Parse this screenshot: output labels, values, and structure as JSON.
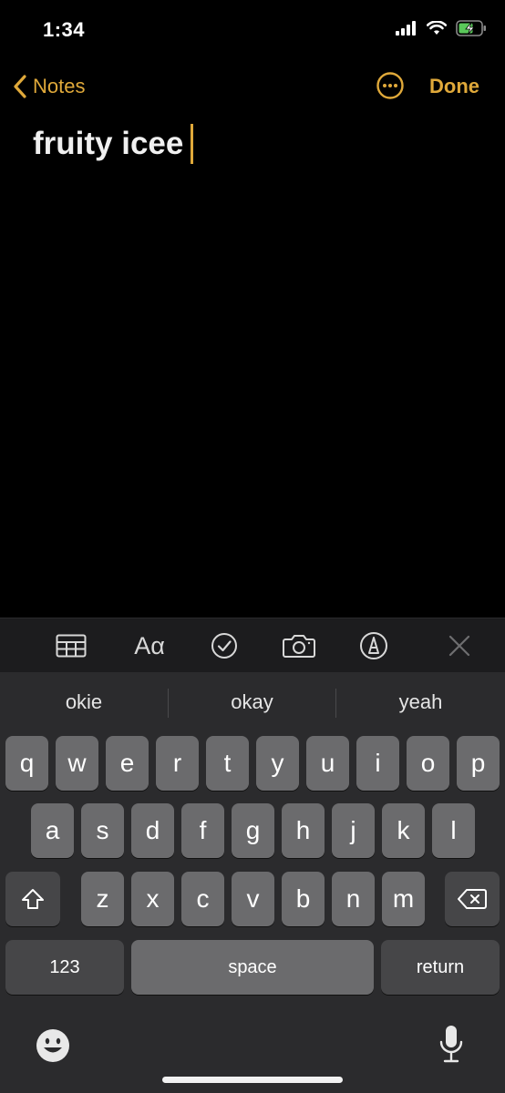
{
  "status_bar": {
    "time": "1:34"
  },
  "nav": {
    "back_label": "Notes",
    "done_label": "Done"
  },
  "note": {
    "title": "fruity icee"
  },
  "toolbar": {
    "aa_label": "Aα"
  },
  "suggestions": [
    "okie",
    "okay",
    "yeah"
  ],
  "keyboard": {
    "row1": [
      "q",
      "w",
      "e",
      "r",
      "t",
      "y",
      "u",
      "i",
      "o",
      "p"
    ],
    "row2": [
      "a",
      "s",
      "d",
      "f",
      "g",
      "h",
      "j",
      "k",
      "l"
    ],
    "row3": [
      "z",
      "x",
      "c",
      "v",
      "b",
      "n",
      "m"
    ],
    "numbers_label": "123",
    "space_label": "space",
    "return_label": "return"
  },
  "colors": {
    "accent": "#e0a93a",
    "keyboard_bg": "#2b2b2d",
    "key": "#6b6b6d",
    "key_dark": "#464648",
    "battery_charging": "#5ac85a"
  },
  "icons": [
    "cellular-signal-icon",
    "wifi-icon",
    "battery-charging-icon",
    "chevron-left-icon",
    "ellipsis-circle-icon",
    "table-icon",
    "checklist-icon",
    "camera-icon",
    "markup-pen-icon",
    "close-icon",
    "shift-icon",
    "delete-icon",
    "emoji-icon",
    "microphone-icon"
  ]
}
